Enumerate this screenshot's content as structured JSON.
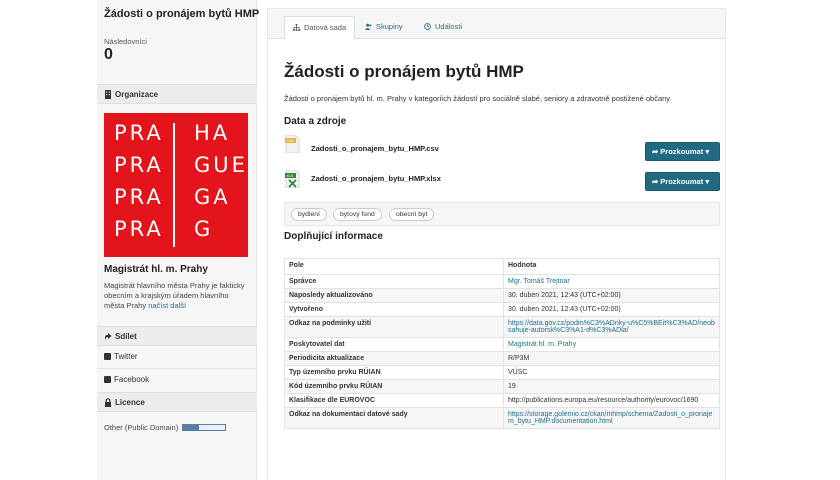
{
  "sidebar": {
    "title": "Žádosti o pronájem bytů HMP",
    "followers_label": "Následovníci",
    "followers_count": "0",
    "organization_header": "Organizace",
    "logo": {
      "rows": [
        [
          "PRA",
          "HA"
        ],
        [
          "PRA",
          "GUE"
        ],
        [
          "PRA",
          "GA"
        ],
        [
          "PRA",
          "G"
        ]
      ],
      "color": "#e3141b"
    },
    "org_name": "Magistrát hl. m. Prahy",
    "org_description": "Magistrát hlavního města Prahy je fakticky obecním a krajským úřadem hlavního města Prahy",
    "read_more": "načíst další",
    "share_header": "Sdílet",
    "share_twitter": "Twitter",
    "share_facebook": "Facebook",
    "license_header": "Licence",
    "license_text": "Other (Public Domain)"
  },
  "tabs": {
    "dataset": "Datová sada",
    "groups": "Skupiny",
    "events": "Události"
  },
  "main": {
    "title": "Žádosti o pronájem bytů HMP",
    "notes": "Žádosti o pronájem bytů hl. m. Prahy v kategoriích žádostí pro sociálně slabé, seniory a zdravotně postižené občany",
    "resources_heading": "Data a zdroje",
    "resources": [
      {
        "name": "Zadosti_o_pronajem_bytu_HMP.csv",
        "format": "CSV",
        "icon_color": "#e8b23a",
        "button": "Prozkoumat"
      },
      {
        "name": "Zadosti_o_pronajem_bytu_HMP.xlsx",
        "format": "XLS",
        "icon_color": "#2e8b3a",
        "button": "Prozkoumat"
      }
    ],
    "tags": [
      "bydlení",
      "bytový fond",
      "obecní byt"
    ],
    "additional_heading": "Doplňující informace",
    "table_headers": [
      "Pole",
      "Hodnota"
    ],
    "table_rows": [
      {
        "key": "Správce",
        "value": "Mgr. Tomáš Trejtnar"
      },
      {
        "key": "Naposledy aktualizováno",
        "value": "30. duben 2021, 12:43 (UTC+02:00)"
      },
      {
        "key": "Vytvořeno",
        "value": "30. duben 2021, 12:43 (UTC+02:00)"
      },
      {
        "key": "Odkaz na podmínky užití",
        "value": "https://data.gov.cz/podm%C3%ADnky-u%C5%BEit%C3%AD/neobsahuje-autorsk%C3%A1-d%C3%ADla/"
      },
      {
        "key": "Poskytovatel dat",
        "value": "Magistrát hl. m. Prahy"
      },
      {
        "key": "Periodicita aktualizace",
        "value": "R/P3M"
      },
      {
        "key": "Typ územního prvku RÚIAN",
        "value": "VÚSC"
      },
      {
        "key": "Kód územního prvku RÚIAN",
        "value": "19"
      },
      {
        "key": "Klasifikace dle EUROVOC",
        "value": "http://publications.europa.eu/resource/authority/eurovoc/1690"
      },
      {
        "key": "Odkaz na dokumentaci datové sady",
        "value": "https://storage.golemio.cz/ckan/mhmp/schema/Zadosti_o_pronajem_bytu_HMP.documentation.html"
      }
    ]
  },
  "colors": {
    "accent_link": "#1f6f8b",
    "button": "#206b82"
  }
}
